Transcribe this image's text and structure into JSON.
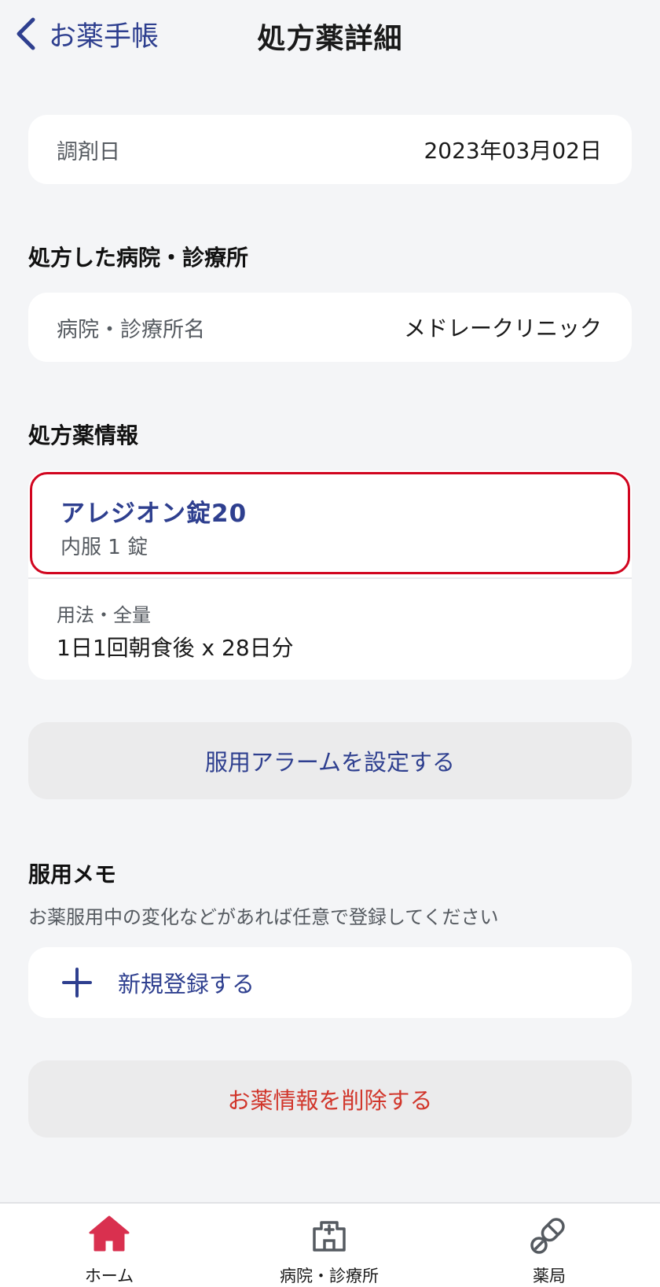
{
  "header": {
    "back_label": "お薬手帳",
    "title": "処方薬詳細"
  },
  "dispensing": {
    "label": "調剤日",
    "value": "2023年03月02日"
  },
  "hospital_section": {
    "title": "処方した病院・診療所",
    "label": "病院・診療所名",
    "value": "メドレークリニック"
  },
  "drug_section": {
    "title": "処方薬情報",
    "drug_name": "アレジオン錠20",
    "drug_dose": "内服 1 錠",
    "usage_label": "用法・全量",
    "usage_value": "1日1回朝食後 x 28日分"
  },
  "alarm_button": "服用アラームを設定する",
  "memo_section": {
    "title": "服用メモ",
    "description": "お薬服用中の変化などがあれば任意で登録してください",
    "new_label": "新規登録する"
  },
  "delete_button": "お薬情報を削除する",
  "tabbar": {
    "items": [
      {
        "label": "ホーム",
        "icon": "home-icon",
        "active": true
      },
      {
        "label": "病院・診療所",
        "icon": "hospital-icon",
        "active": false
      },
      {
        "label": "薬局",
        "icon": "pill-icon",
        "active": false
      }
    ]
  },
  "colors": {
    "accent": "#2e3f8f",
    "danger": "#d1362b",
    "highlight_border": "#d1051f",
    "active_tab": "#d9304f",
    "background": "#f4f5f7"
  }
}
